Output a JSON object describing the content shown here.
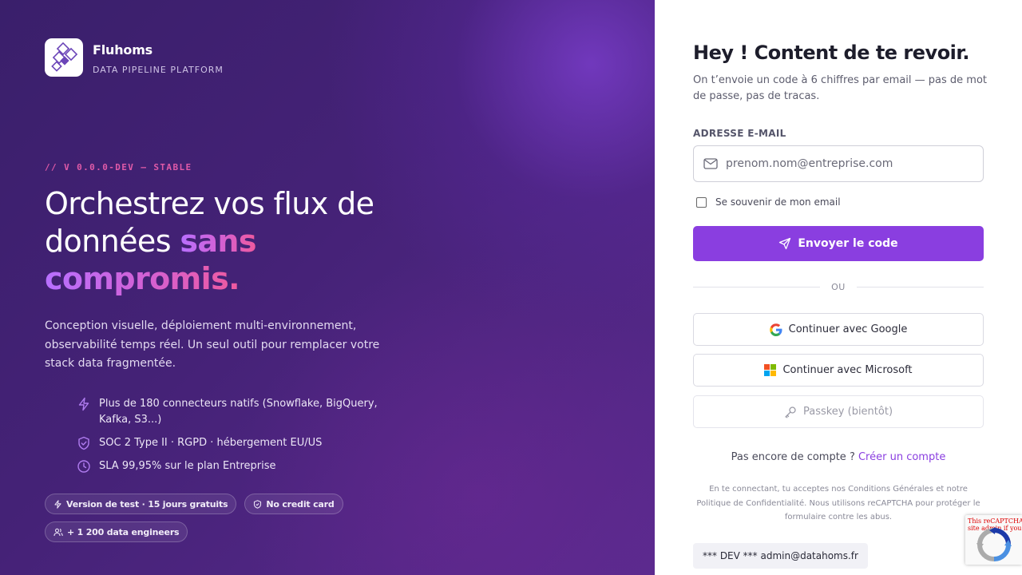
{
  "brand": {
    "name": "Fluhoms",
    "tagline": "DATA PIPELINE PLATFORM"
  },
  "hero": {
    "version": "// V 0.0.0-DEV — STABLE",
    "headline_line1": "Orchestrez vos flux de",
    "headline_line2_plain": "données ",
    "headline_highlight1": "sans",
    "headline_highlight2": "compromis.",
    "description": "Conception visuelle, déploiement multi-environnement, observabilité temps réel. Un seul outil pour remplacer votre stack data fragmentée."
  },
  "features": [
    {
      "icon": "lightning-icon",
      "text": "Plus de 180 connecteurs natifs (Snowflake, BigQuery, Kafka, S3...)"
    },
    {
      "icon": "shield-check-icon",
      "text": "SOC 2 Type II · RGPD · hébergement EU/US"
    },
    {
      "icon": "clock-icon",
      "text": "SLA 99,95% sur le plan Entreprise"
    }
  ],
  "pills": {
    "trial": "Version de test · 15 jours gratuits",
    "no_card": "No credit card",
    "engineers": "+ 1 200 data engineers"
  },
  "login": {
    "title": "Hey ! Content de te revoir.",
    "subtitle": "On t’envoie un code à 6 chiffres par email — pas de mot de passe, pas de tracas.",
    "email_label": "ADRESSE E-MAIL",
    "email_placeholder": "prenom.nom@entreprise.com",
    "email_value": "",
    "remember_label": "Se souvenir de mon email",
    "remember_checked": false,
    "send_button": "Envoyer le code",
    "divider": "OU",
    "google_button": "Continuer avec Google",
    "microsoft_button": "Continuer avec Microsoft",
    "passkey_button": "Passkey (bientôt)",
    "signup_prompt": "Pas encore de compte ?",
    "signup_link": "Créer un compte",
    "legal": "En te connectant, tu acceptes nos Conditions Générales et notre Politique de Confidentialité. Nous utilisons reCAPTCHA pour protéger le formulaire contre les abus.",
    "dev_badge": "*** DEV *** admin@datahoms.fr"
  },
  "recaptcha": {
    "text_line1": "This reCAPTCHA",
    "text_line2": "site admin if you are"
  },
  "colors": {
    "accent": "#8a3ee0",
    "left_bg": "#452277",
    "pink_accent": "#e05aa8"
  }
}
